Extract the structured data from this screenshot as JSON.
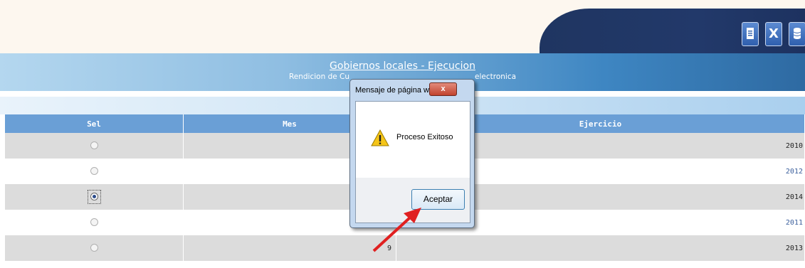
{
  "header": {
    "toolbar": [
      {
        "name": "report-icon",
        "label": ""
      },
      {
        "name": "excel-icon",
        "label": "X"
      },
      {
        "name": "database-icon",
        "label": ""
      }
    ]
  },
  "banner": {
    "title": "Gobiernos locales - Ejecucion",
    "subtitle_left": "Rendicion de Cu",
    "subtitle_right": "electronica"
  },
  "table": {
    "columns": [
      "Sel",
      "Mes",
      "Ejercicio"
    ],
    "rows": [
      {
        "selected": false,
        "mes": "",
        "ejercicio": "2010"
      },
      {
        "selected": false,
        "mes": "",
        "ejercicio": "2012"
      },
      {
        "selected": true,
        "mes": "",
        "ejercicio": "2014"
      },
      {
        "selected": false,
        "mes": "",
        "ejercicio": "2011"
      },
      {
        "selected": false,
        "mes": "9",
        "ejercicio": "2013"
      }
    ]
  },
  "dialog": {
    "title": "Mensaje de página web",
    "close_label": "x",
    "message": "Proceso Exitoso",
    "ok_label": "Aceptar",
    "icon": "warning-icon"
  },
  "colors": {
    "header_navy": "#1f3561",
    "table_header": "#6a9fd6",
    "arrow": "#e02020"
  }
}
